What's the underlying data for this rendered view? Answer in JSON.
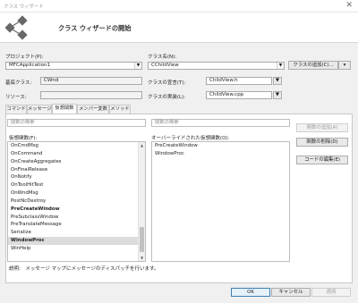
{
  "window": {
    "title": "クラス ウィザード",
    "close_glyph": "✕"
  },
  "banner": {
    "title": "クラス ウィザードの開始"
  },
  "project": {
    "label": "プロジェクト(P):",
    "value": "MFCApplication1"
  },
  "class_name": {
    "label": "クラス名(N):",
    "value": "CChildView"
  },
  "add_class_button": {
    "label": "クラスの追加(C)...",
    "arrow": "▾"
  },
  "base_class": {
    "label": "基底クラス:",
    "value": "CWnd"
  },
  "class_declaration": {
    "label": "クラスの宣言(T):",
    "value": "ChildView.h"
  },
  "resource": {
    "label": "リソース:"
  },
  "class_implementation": {
    "label": "クラスの実装(L):",
    "value": "ChildView.cpp"
  },
  "tabs": [
    {
      "label": "コマンド"
    },
    {
      "label": "メッセージ"
    },
    {
      "label": "仮想関数"
    },
    {
      "label": "メンバー変数"
    },
    {
      "label": "メソッド"
    }
  ],
  "active_tab": 2,
  "virtual_search": {
    "placeholder": "関数の検索"
  },
  "override_search": {
    "placeholder": "関数の検索"
  },
  "virtual_list": {
    "label": "仮想関数(F):",
    "items": [
      {
        "text": "OnCmdMsg",
        "bold": false
      },
      {
        "text": "OnCommand",
        "bold": false
      },
      {
        "text": "OnCreateAggregates",
        "bold": false
      },
      {
        "text": "OnFinalRelease",
        "bold": false
      },
      {
        "text": "OnNotify",
        "bold": false
      },
      {
        "text": "OnToolHitTest",
        "bold": false
      },
      {
        "text": "OnWndMsg",
        "bold": false
      },
      {
        "text": "PostNcDestroy",
        "bold": false
      },
      {
        "text": "PreCreateWindow",
        "bold": true
      },
      {
        "text": "PreSubclassWindow",
        "bold": false
      },
      {
        "text": "PreTranslateMessage",
        "bold": false
      },
      {
        "text": "Serialize",
        "bold": false
      },
      {
        "text": "WindowProc",
        "bold": true,
        "selected": true
      },
      {
        "text": "WinHelp",
        "bold": false
      }
    ]
  },
  "override_list": {
    "label": "オーバーライドされた仮想関数(O):",
    "items": [
      {
        "text": "PreCreateWindow"
      },
      {
        "text": "WindowProc"
      }
    ]
  },
  "function_buttons": {
    "add": "関数の追加(A)",
    "delete": "関数の削除(D)",
    "edit": "コードの編集(E)"
  },
  "description": "説明:　メッセージ マップにメッセージのディスパッチを行います。",
  "dialog_buttons": {
    "ok": "OK",
    "cancel": "キャンセル",
    "apply": "適用"
  },
  "colors": {
    "banner_bg": "#ffffff",
    "logo": "#686868",
    "selected_row": "#dcdcdc",
    "ok_border": "#3c7fb1"
  }
}
